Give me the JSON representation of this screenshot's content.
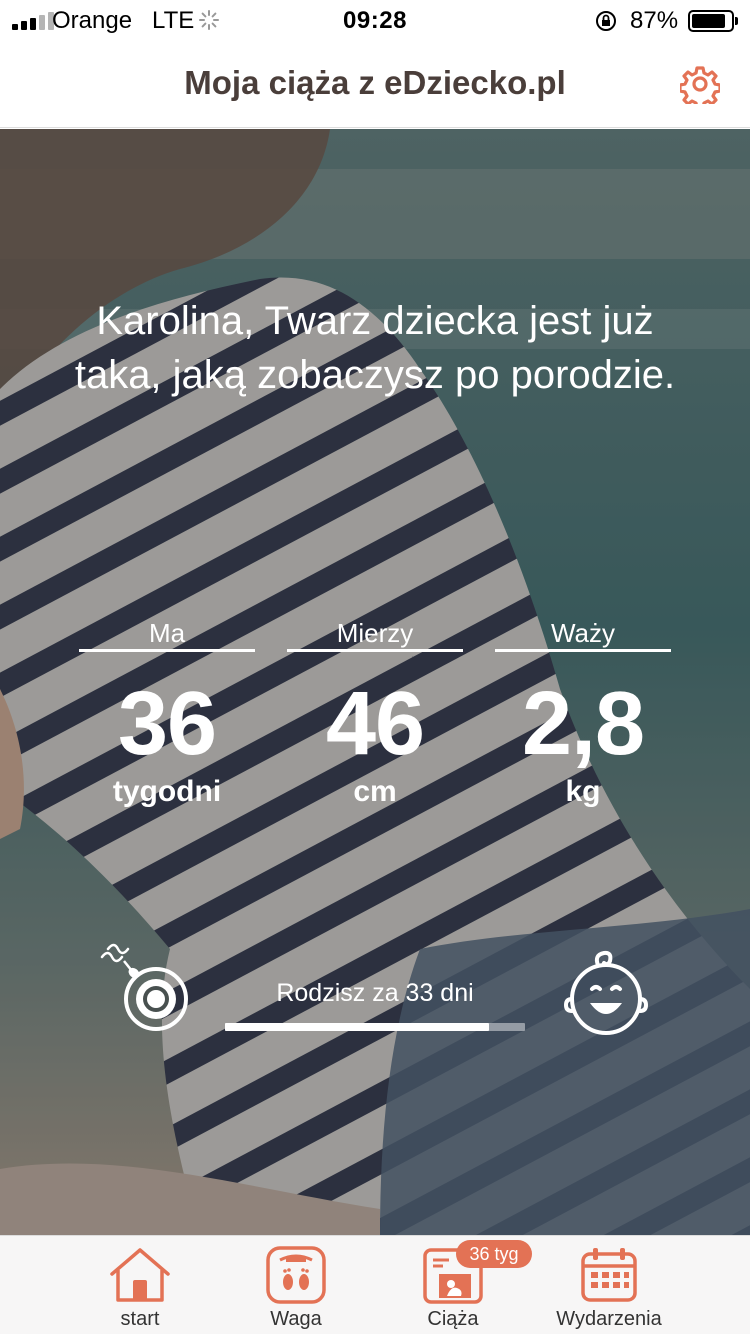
{
  "status_bar": {
    "carrier": "Orange",
    "network": "LTE",
    "time": "09:28",
    "battery_percent": "87%",
    "battery_level": 0.87
  },
  "header": {
    "title": "Moja ciąża z eDziecko.pl",
    "settings_icon": "gear-icon"
  },
  "hero": {
    "message": "Karolina, Twarz dziecka jest już taka, jaką zobaczysz po porodzie.",
    "stats": [
      {
        "label": "Ma",
        "value": "36",
        "unit": "tygodni"
      },
      {
        "label": "Mierzy",
        "value": "46",
        "unit": "cm"
      },
      {
        "label": "Waży",
        "value": "2,8",
        "unit": "kg"
      }
    ],
    "countdown": "Rodzisz za 33 dni",
    "progress": 0.88
  },
  "tabs": [
    {
      "label": "start",
      "icon": "house-icon"
    },
    {
      "label": "Waga",
      "icon": "scale-icon"
    },
    {
      "label": "Ciąża",
      "icon": "pregnancy-calendar-icon",
      "badge": "36 tyg"
    },
    {
      "label": "Wydarzenia",
      "icon": "calendar-icon"
    }
  ],
  "colors": {
    "accent": "#e37255",
    "header_title": "#4a3e3a",
    "tab_background": "#f7f6f6"
  }
}
